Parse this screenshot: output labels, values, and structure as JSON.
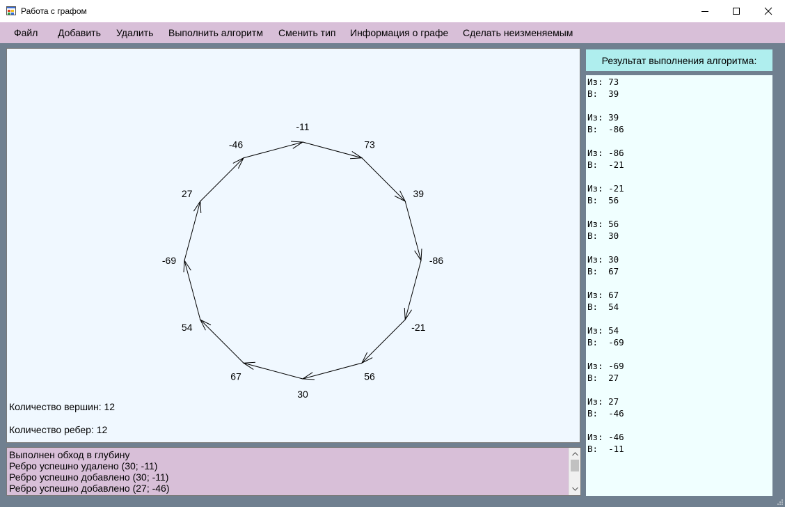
{
  "window": {
    "title": "Работа с графом",
    "controls": [
      "minimize",
      "maximize",
      "close"
    ]
  },
  "menu": {
    "items": [
      "Файл",
      "Добавить",
      "Удалить",
      "Выполнить алгоритм",
      "Сменить тип",
      "Информация о графе",
      "Сделать неизменяемым"
    ]
  },
  "graph": {
    "directed": true,
    "vertices": [
      "-11",
      "73",
      "39",
      "-86",
      "-21",
      "56",
      "30",
      "67",
      "54",
      "-69",
      "27",
      "-46"
    ],
    "edges": [
      {
        "from": "-11",
        "to": "73"
      },
      {
        "from": "73",
        "to": "39"
      },
      {
        "from": "39",
        "to": "-86"
      },
      {
        "from": "-86",
        "to": "-21"
      },
      {
        "from": "-21",
        "to": "56"
      },
      {
        "from": "56",
        "to": "30"
      },
      {
        "from": "30",
        "to": "67"
      },
      {
        "from": "67",
        "to": "54"
      },
      {
        "from": "54",
        "to": "-69"
      },
      {
        "from": "-69",
        "to": "27"
      },
      {
        "from": "27",
        "to": "-46"
      },
      {
        "from": "-46",
        "to": "-11"
      }
    ],
    "vertex_count_text": "Количество вершин: 12",
    "edge_count_text": "Количество ребер: 12"
  },
  "log": {
    "lines": [
      "Выполнен обход в глубину",
      "Ребро успешно удалено (30; -11)",
      "Ребро успешно добавлено (30; -11)",
      "Ребро успешно добавлено (27; -46)"
    ]
  },
  "result": {
    "header": "Результат выполнения алгоритма:",
    "steps": [
      {
        "from": "73",
        "to": "39"
      },
      {
        "from": "39",
        "to": "-86"
      },
      {
        "from": "-86",
        "to": "-21"
      },
      {
        "from": "-21",
        "to": "56"
      },
      {
        "from": "56",
        "to": "30"
      },
      {
        "from": "30",
        "to": "67"
      },
      {
        "from": "67",
        "to": "54"
      },
      {
        "from": "54",
        "to": "-69"
      },
      {
        "from": "-69",
        "to": "27"
      },
      {
        "from": "27",
        "to": "-46"
      },
      {
        "from": "-46",
        "to": "-11"
      }
    ],
    "from_label": "Из:",
    "to_label": "В:"
  },
  "colors": {
    "background": "#708090",
    "menu": "#d8bfd8",
    "canvas": "#f0f8ff",
    "result_header": "#afeeee",
    "result_panel": "#f0ffff"
  }
}
